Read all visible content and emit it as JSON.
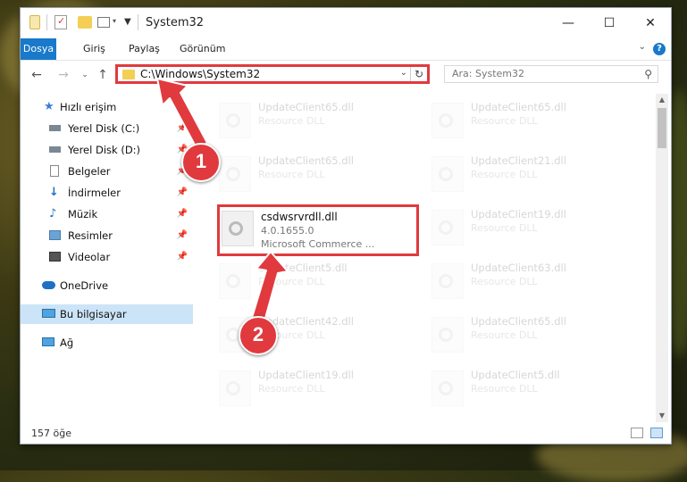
{
  "window": {
    "title": "System32",
    "controls": {
      "minimize": "—",
      "maximize": "☐",
      "close": "✕"
    }
  },
  "ribbon": {
    "tabs": [
      "Dosya",
      "Giriş",
      "Paylaş",
      "Görünüm"
    ],
    "active_tab": "Dosya",
    "accent": "#1979ca",
    "help": "?"
  },
  "navbar": {
    "address": "C:\\Windows\\System32",
    "search_placeholder": "Ara: System32",
    "highlight_color": "#e03a3e"
  },
  "sidebar": {
    "items": [
      {
        "label": "Hızlı erişim",
        "icon": "star-icon",
        "pinned": false
      },
      {
        "label": "Yerel Disk (C:)",
        "icon": "drive-icon",
        "pinned": true
      },
      {
        "label": "Yerel Disk (D:)",
        "icon": "drive-icon",
        "pinned": true
      },
      {
        "label": "Belgeler",
        "icon": "documents-icon",
        "pinned": true
      },
      {
        "label": "İndirmeler",
        "icon": "download-icon",
        "pinned": true
      },
      {
        "label": "Müzik",
        "icon": "music-icon",
        "pinned": true
      },
      {
        "label": "Resimler",
        "icon": "pictures-icon",
        "pinned": true
      },
      {
        "label": "Videolar",
        "icon": "videos-icon",
        "pinned": true
      },
      {
        "label": "OneDrive",
        "icon": "cloud-icon",
        "pinned": false
      },
      {
        "label": "Bu bilgisayar",
        "icon": "computer-icon",
        "pinned": false,
        "selected": true
      },
      {
        "label": "Ağ",
        "icon": "network-icon",
        "pinned": false
      }
    ]
  },
  "files": {
    "left": [
      {
        "name": "UpdateClient65.dll",
        "type": "Resource DLL"
      },
      {
        "name": "UpdateClient65.dll",
        "type": "Resource DLL"
      },
      {
        "name": "csdwsrvrdll.dll",
        "version": "4.0.1655.0",
        "company": "Microsoft Commerce ..."
      },
      {
        "name": "UpdateClient5.dll",
        "type": "Resource DLL"
      },
      {
        "name": "UpdateClient42.dll",
        "type": "Resource DLL"
      },
      {
        "name": "UpdateClient19.dll",
        "type": "Resource DLL"
      }
    ],
    "right": [
      {
        "name": "UpdateClient65.dll",
        "type": "Resource DLL"
      },
      {
        "name": "UpdateClient21.dll",
        "type": "Resource DLL"
      },
      {
        "name": "UpdateClient19.dll",
        "type": "Resource DLL"
      },
      {
        "name": "UpdateClient63.dll",
        "type": "Resource DLL"
      },
      {
        "name": "UpdateClient65.dll",
        "type": "Resource DLL"
      },
      {
        "name": "UpdateClient5.dll",
        "type": "Resource DLL"
      }
    ]
  },
  "status": {
    "count": "157 öğe"
  },
  "annotations": {
    "step1": "1",
    "step2": "2"
  }
}
